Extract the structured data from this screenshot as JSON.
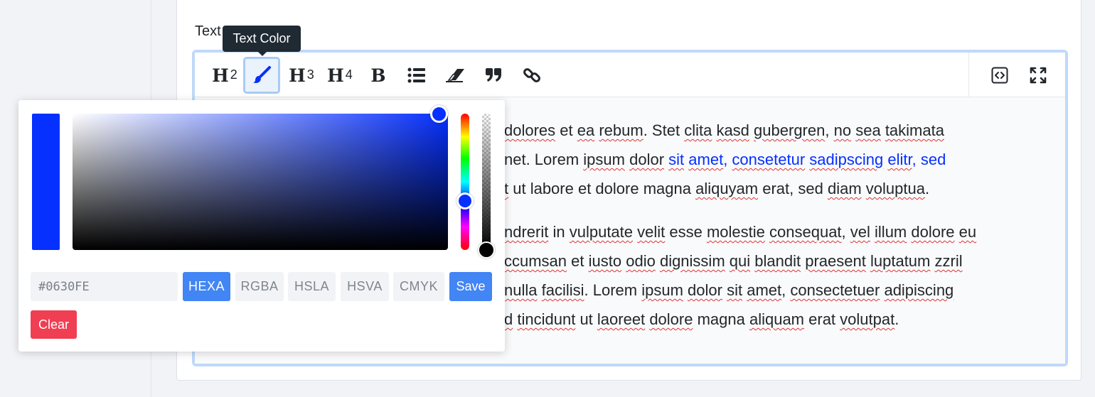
{
  "field": {
    "label": "Text"
  },
  "toolbar": {
    "h2": {
      "letter": "H",
      "level": "2"
    },
    "h3": {
      "letter": "H",
      "level": "3"
    },
    "h4": {
      "letter": "H",
      "level": "4"
    },
    "bold": "B",
    "icons": [
      "heading-2-icon",
      "brush-icon",
      "heading-3-icon",
      "heading-4-icon",
      "bold-icon",
      "bullet-list-icon",
      "eraser-icon",
      "quote-icon",
      "link-icon",
      "code-view-icon",
      "fullscreen-icon"
    ]
  },
  "tooltip": {
    "text": "Text Color"
  },
  "content": {
    "p1": {
      "l1a": "dolores",
      "l1b": " et ",
      "l1c": "ea",
      "l1d": " ",
      "l1e": "rebum",
      "l1f": ". Stet ",
      "l1g": "clita",
      "l1h": " ",
      "l1i": "kasd",
      "l1j": " ",
      "l1k": "gubergren",
      "l1l": ", ",
      "l1m": "no",
      "l1n": " ",
      "l1o": "sea",
      "l1p": " ",
      "l1q": "takimata",
      "l2a": "net. Lorem ",
      "l2b": "ipsum",
      "l2c": " ",
      "l2d": "dolor",
      "l2e": " ",
      "l2f": "sit",
      "l2g": " ",
      "l2h": "amet",
      "l2i": ", ",
      "l2j": "consetetur",
      "l2k": " ",
      "l2l": "sadipscing",
      "l2m": " ",
      "l2n": "elitr",
      "l2o": ", sed",
      "l3a": "t",
      "l3b": " ut labore et dolore magna ",
      "l3c": "aliquyam",
      "l3d": " erat, sed ",
      "l3e": "diam",
      "l3f": " ",
      "l3g": "voluptua",
      "l3h": "."
    },
    "p2": {
      "l1a": "ndrerit",
      "l1b": " in ",
      "l1c": "vulputate",
      "l1d": " ",
      "l1e": "velit",
      "l1f": " esse ",
      "l1g": "molestie",
      "l1h": " ",
      "l1i": "consequat",
      "l1j": ", ",
      "l1k": "vel",
      "l1l": " ",
      "l1m": "illum",
      "l1n": " ",
      "l1o": "dolore",
      "l1p": " ",
      "l1q": "eu",
      "l2a": "ccumsan",
      "l2b": " et ",
      "l2c": "iusto",
      "l2d": " ",
      "l2e": "odio",
      "l2f": " ",
      "l2g": "dignissim",
      "l2h": " ",
      "l2i": "qui",
      "l2j": " ",
      "l2k": "blandit",
      "l2l": " ",
      "l2m": "praesent",
      "l2n": " ",
      "l2o": "luptatum",
      "l2p": " ",
      "l2q": "zzril",
      "l3a": "nulla",
      "l3b": " ",
      "l3c": "facilisi",
      "l3d": ". Lorem ",
      "l3e": "ipsum",
      "l3f": " ",
      "l3g": "dolor",
      "l3h": " ",
      "l3i": "sit",
      "l3j": " ",
      "l3k": "amet",
      "l3l": ", ",
      "l3m": "consectetuer",
      "l3n": " ",
      "l3o": "adipiscing",
      "l4a": "d",
      "l4b": " ",
      "l4c": "tincidunt",
      "l4d": " ut ",
      "l4e": "laoreet",
      "l4f": " ",
      "l4g": "dolore",
      "l4h": " magna ",
      "l4i": "aliquam",
      "l4j": " erat ",
      "l4k": "volutpat",
      "l4l": "."
    }
  },
  "picker": {
    "hex_value": "#0630FE",
    "modes": [
      "HEXA",
      "RGBA",
      "HSLA",
      "HSVA",
      "CMYK"
    ],
    "active_mode": "HEXA",
    "save_label": "Save",
    "clear_label": "Clear"
  },
  "colors": {
    "selected": "#0630FE",
    "primary_button": "#4285F4",
    "danger_button": "#F03E52",
    "editor_focus": "#BFD9FA"
  }
}
